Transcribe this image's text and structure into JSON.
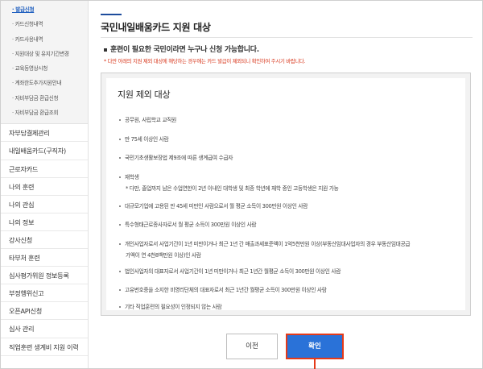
{
  "sidebar": {
    "sub_items": [
      {
        "label": "· 발급신청",
        "active": true
      },
      {
        "label": "· 카드신청내역",
        "active": false
      },
      {
        "label": "· 카드사용내역",
        "active": false
      },
      {
        "label": "· 지원대상 및 유지기간변경",
        "active": false
      },
      {
        "label": "· 교육동영상시청",
        "active": false
      },
      {
        "label": "· 계좌한도추가지원안내",
        "active": false
      },
      {
        "label": "· 자비부담금 환급신청",
        "active": false
      },
      {
        "label": "· 자비부담금 환급조회",
        "active": false
      }
    ],
    "menu_items": [
      "자부담결제관리",
      "내일배움카드(구직자)",
      "근로자카드",
      "나의 훈련",
      "나의 관심",
      "나의 정보",
      "강사신청",
      "타부처 훈련",
      "심사평가위원 정보등록",
      "부정행위신고",
      "오픈API신청",
      "심사 관리",
      "직업훈련 생계비 지원 이력"
    ]
  },
  "main": {
    "title": "국민내일배움카드 지원 대상",
    "notice": "훈련이 필요한 국민이라면 누구나 신청 가능합니다.",
    "warning": "* 다만 아래의 지원 제외 대상에 해당하는 경우에는 카드 발급이 제외되니 확인하여 주시기 바랍니다.",
    "exclusion": {
      "title": "지원 제외 대상",
      "items": [
        {
          "text": "공무원, 사립학교 교직원"
        },
        {
          "text": "만 75세 이상인 사람"
        },
        {
          "text": "국민기초생활보장법 제9조에 따른 생계급여 수급자"
        },
        {
          "text": "재학생",
          "sub": "* 다만, 졸업까지 남은 수업연한이 2년 이내인 대학생 및 최종 학년에 재학 중인 고등학생은 지원 가능"
        },
        {
          "text": "대규모기업에 고용된 만 45세 미만인 사람으로서 월 평균 소득이 300만원 이상인 사람"
        },
        {
          "text": "특수형태근로종사자로서 월 평균 소득이 300만원 이상인 사람"
        },
        {
          "text": "개인사업자로서 사업기간이 1년 미만이거나 최근 1년 간 매출과세표준액이 1억5천만원 이상(부동산임대사업자의 경우 부동산임대공급",
          "sub": "가액이 연 4천8백만원 이상)인 사람"
        },
        {
          "text": "법인사업자의 대표자로서 사업기간이 1년 미만이거나 최근 1년간 월평균 소득이 300만원 이상인 사람"
        },
        {
          "text": "고유번호증을 소지한 비영리단체의 대표자로서 최근 1년간 월평균 소득이 300만원 이상인 사람"
        },
        {
          "text": "기타 직업훈련의 필요성이 인정되지 않는 사람"
        }
      ]
    },
    "buttons": {
      "prev": "이전",
      "confirm": "확인"
    }
  },
  "colors": {
    "accent": "#2a72d8",
    "highlight": "#e53a19",
    "warning": "#d8351a",
    "active_link": "#1f5fbf"
  }
}
